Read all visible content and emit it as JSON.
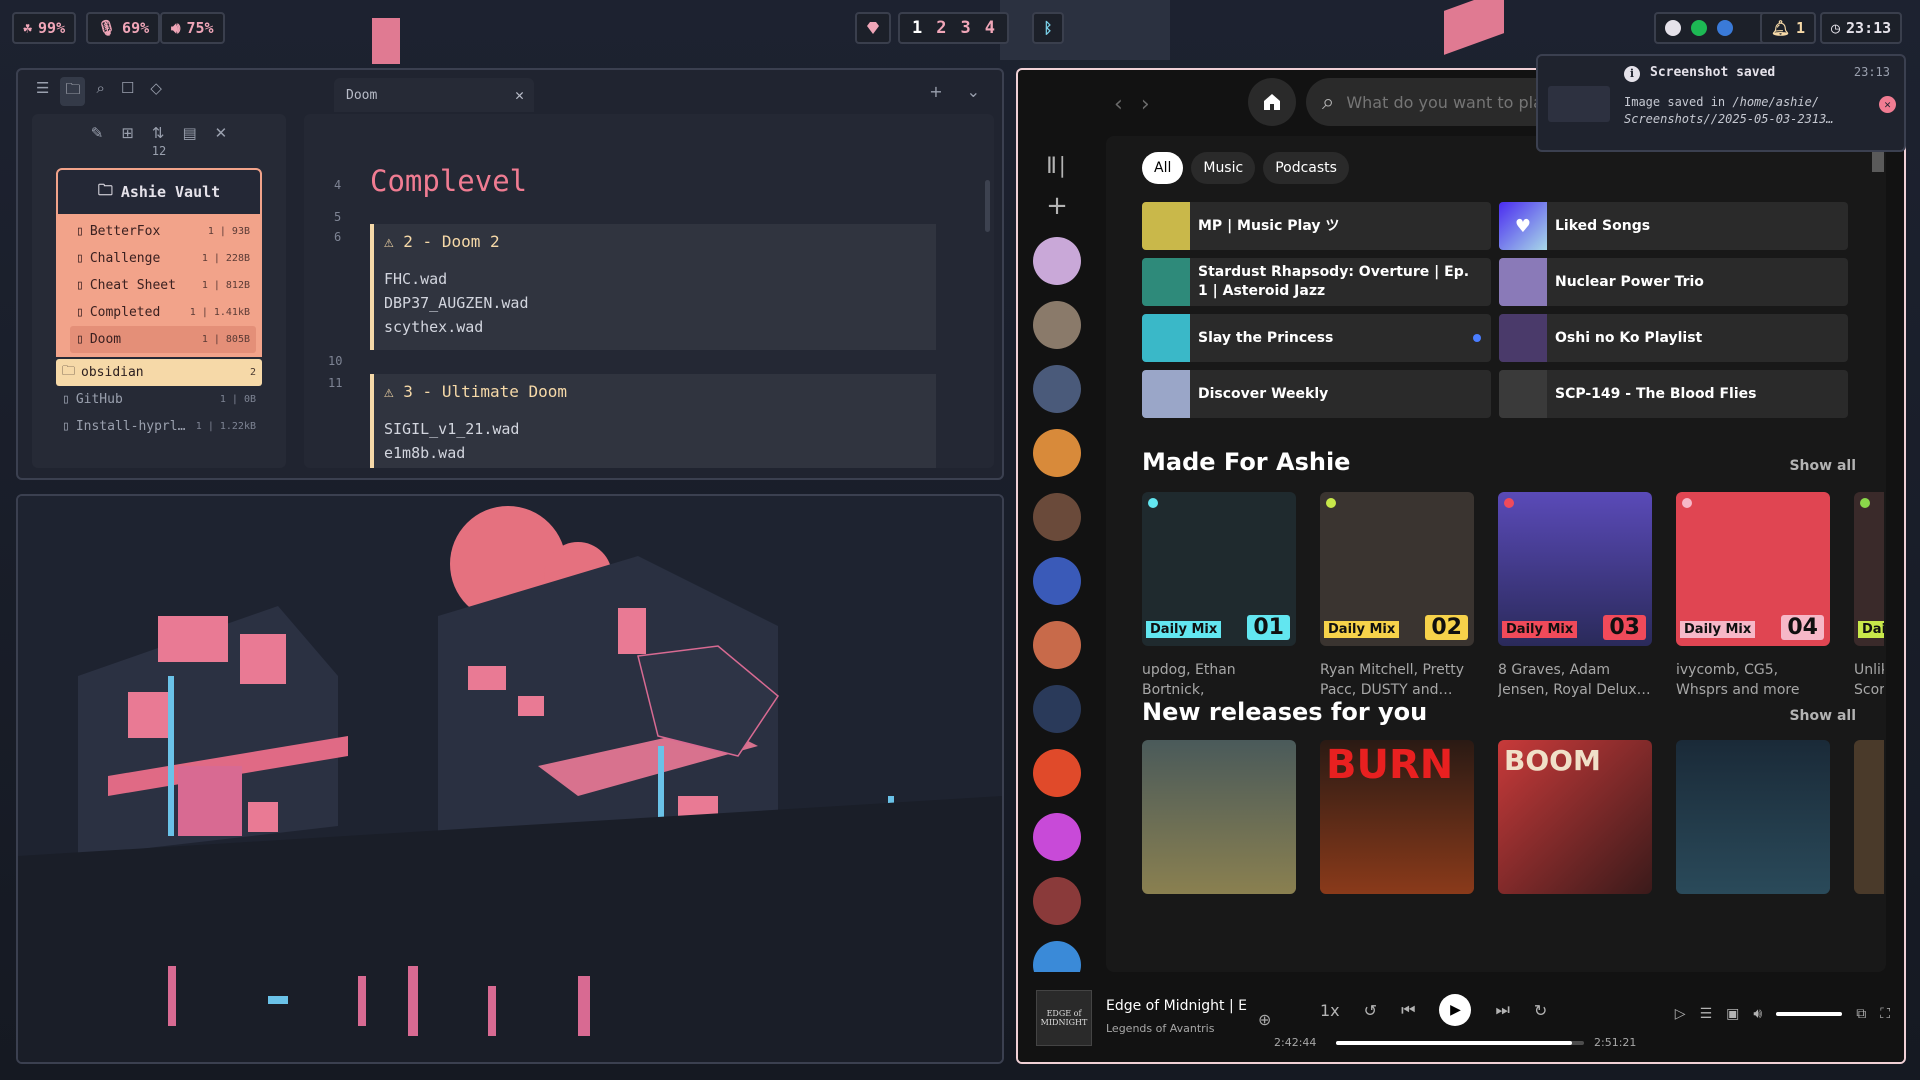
{
  "topbar": {
    "battery": "99%",
    "mic": "69%",
    "volume": "75%",
    "workspaces": [
      "1",
      "2",
      "3",
      "4"
    ],
    "notifications": "1",
    "clock": "23:13"
  },
  "obsidian": {
    "tab_title": "Doom",
    "file_count": "12",
    "vault_name": "Ashie Vault",
    "files": [
      {
        "name": "BetterFox",
        "meta": "1 | 93B"
      },
      {
        "name": "Challenge",
        "meta": "1 | 228B"
      },
      {
        "name": "Cheat Sheet",
        "meta": "1 | 812B"
      },
      {
        "name": "Completed",
        "meta": "1 | 1.41kB"
      },
      {
        "name": "Doom",
        "meta": "1 | 805B"
      }
    ],
    "folder": {
      "name": "obsidian",
      "meta": "2"
    },
    "other_files": [
      {
        "name": "GitHub",
        "meta": "1 | 0B"
      },
      {
        "name": "Install-hyprl…",
        "meta": "1 | 1.22kB"
      }
    ],
    "line_numbers": [
      "4",
      "5",
      "6",
      "10",
      "11"
    ],
    "heading": "Complevel",
    "callouts": [
      {
        "title": "2 - Doom 2",
        "items": [
          "FHC.wad",
          "DBP37_AUGZEN.wad",
          "scythex.wad"
        ]
      },
      {
        "title": "3 - Ultimate Doom",
        "items": [
          "SIGIL_v1_21.wad",
          "e1m8b.wad"
        ]
      }
    ]
  },
  "notification": {
    "title": "Screenshot saved",
    "time": "23:13",
    "body_prefix": "Image saved in ",
    "body_path": "/home/ashie/ Screenshots//2025-05-03-2313…"
  },
  "spotify": {
    "search_placeholder": "What do you want to play?",
    "chips": [
      "All",
      "Music",
      "Podcasts"
    ],
    "quick": [
      {
        "title": "MP | Music Play ツ",
        "color": "#c9b84a"
      },
      {
        "title": "Liked Songs",
        "color": "#6a4cf0"
      },
      {
        "title": "Stardust Rhapsody: Overture | Ep. 1 | Asteroid Jazz",
        "color": "#2e8a7a"
      },
      {
        "title": "Nuclear Power Trio",
        "color": "#8a7ab8"
      },
      {
        "title": "Slay the Princess",
        "color": "#3ab8c8"
      },
      {
        "title": "Oshi no Ko Playlist",
        "color": "#4a3a6a"
      },
      {
        "title": "Discover Weekly",
        "color": "#9aa6c8"
      },
      {
        "title": "SCP-149 - The Blood Flies",
        "color": "#3a3a3a"
      }
    ],
    "made_for": {
      "title": "Made For Ashie",
      "show_all": "Show all",
      "cards": [
        {
          "label": "Daily Mix",
          "num": "01",
          "desc": "updog, Ethan Bortnick, angelbaby…",
          "bg": "#1f2a2e",
          "accent": "#62e6f0"
        },
        {
          "label": "Daily Mix",
          "num": "02",
          "desc": "Ryan Mitchell, Pretty Pacc, DUSTY and…",
          "bg": "#3a3430",
          "accent": "#62e6f0"
        },
        {
          "label": "Daily Mix",
          "num": "03",
          "desc": "8 Graves, Adam Jensen, Royal Delux…",
          "bg": "#3a3d8a",
          "accent": "#62e6f0"
        },
        {
          "label": "Daily Mix",
          "num": "04",
          "desc": "ivycomb, CG5, Whsprs and more",
          "bg": "#e04552",
          "accent": "#62e6f0"
        },
        {
          "label": "Daily",
          "num": "",
          "desc": "Unlike Score",
          "bg": "#3a2a2a",
          "accent": "#62e6f0"
        }
      ]
    },
    "new_releases": {
      "title": "New releases for you",
      "show_all": "Show all",
      "covers": [
        {
          "bg": "#6a6e4a",
          "text": ""
        },
        {
          "bg": "#2a1a14",
          "text": "BURN"
        },
        {
          "bg": "#b83a3a",
          "text": "BOOM"
        },
        {
          "bg": "#1a2a38",
          "text": ""
        },
        {
          "bg": "#4a3a2a",
          "text": ""
        }
      ]
    },
    "player": {
      "cover_text": "EDGE of MIDNIGHT",
      "track": "Edge of Midnight | Ep.",
      "artist": "Legends of Avantris",
      "speed": "1x",
      "elapsed": "2:42:44",
      "total": "2:51:21",
      "progress": 0.95,
      "volume": 1.0
    },
    "library_avatars": [
      "#c9a8d8",
      "#8a7a6a",
      "#4a5a7a",
      "#d88a3a",
      "#6a4a3a",
      "#3a5ab8",
      "#c86a4a",
      "#2a3a5a",
      "#e04a2a",
      "#c84ad8",
      "#8a3a3a",
      "#3a8ad8"
    ]
  }
}
